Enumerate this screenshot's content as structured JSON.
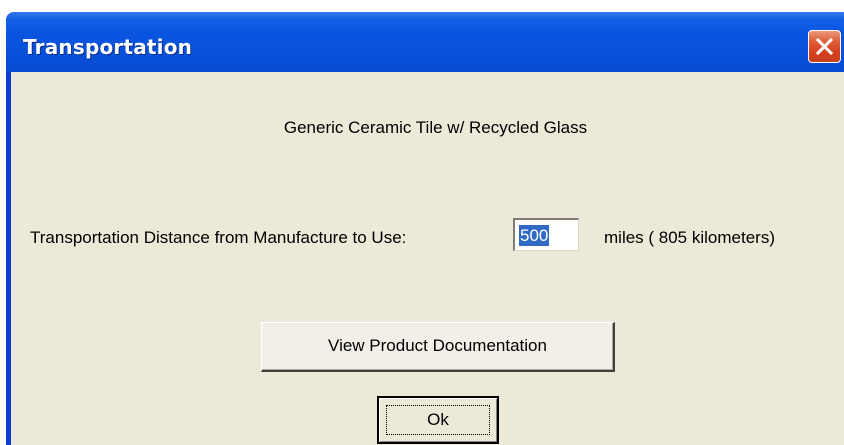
{
  "window": {
    "title": "Transportation"
  },
  "product": {
    "name": "Generic Ceramic Tile w/ Recycled Glass"
  },
  "distance": {
    "label": "Transportation Distance from Manufacture to Use:",
    "value": "500",
    "unit_text": "miles ( 805 kilometers)"
  },
  "buttons": {
    "documentation_label": "View Product Documentation",
    "ok_label": "Ok"
  },
  "icons": {
    "close": "close-icon"
  },
  "colors": {
    "titlebar": "#0a55e0",
    "client_bg": "#ece9d8",
    "close_button": "#d5401d",
    "selection": "#316ac5"
  }
}
